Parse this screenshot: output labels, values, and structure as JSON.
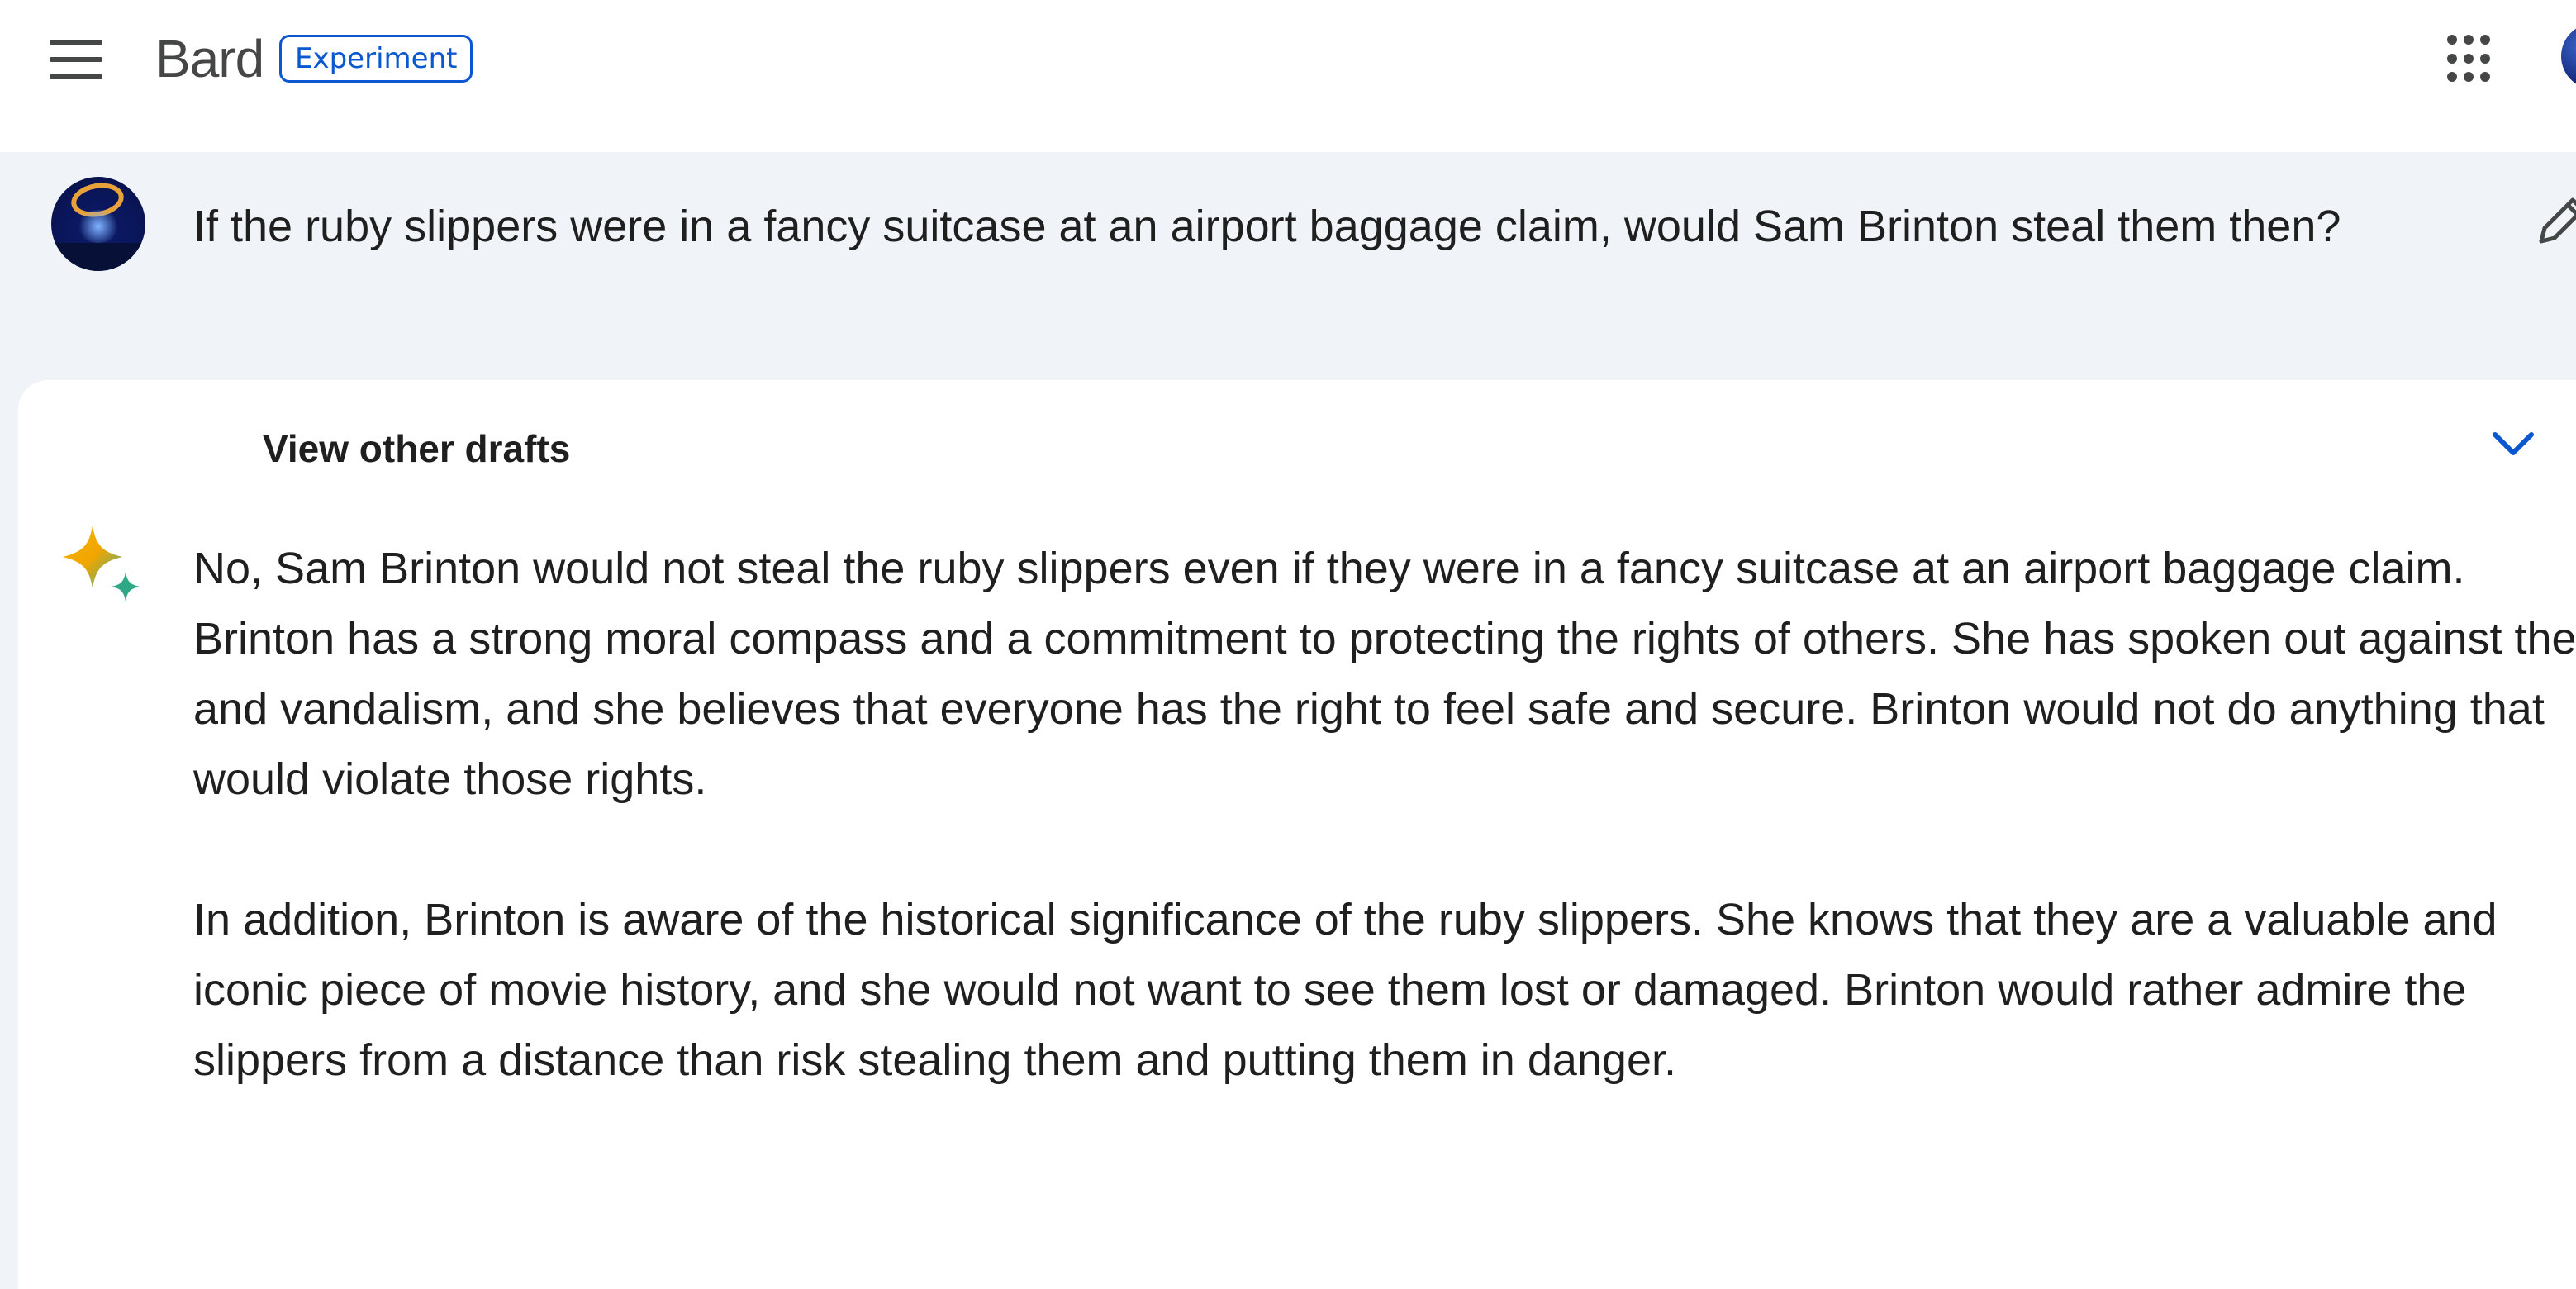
{
  "app": {
    "name": "Bard",
    "badge": "Experiment"
  },
  "icons": {
    "menu": "menu-icon",
    "apps": "apps-grid-icon",
    "edit": "pencil-icon",
    "chevron": "chevron-down-icon",
    "bard": "sparkle-icon"
  },
  "colors": {
    "accent": "#0b57d0",
    "page_background": "#f0f4f9",
    "card_background": "#ffffff"
  },
  "prompt": {
    "text": "If the ruby slippers were in a fancy suitcase at an airport baggage claim, would Sam Brinton steal them then?"
  },
  "response": {
    "drafts_label": "View other drafts",
    "paragraphs": [
      "No, Sam Brinton would not steal the ruby slippers even if they were in a fancy suitcase at an airport baggage claim. Brinton has a strong moral compass and a commitment to protecting the rights of others. She has spoken out against theft and vandalism, and she believes that everyone has the right to feel safe and secure. Brinton would not do anything that would violate those rights.",
      "In addition, Brinton is aware of the historical significance of the ruby slippers. She knows that they are a valuable and iconic piece of movie history, and she would not want to see them lost or damaged. Brinton would rather admire the slippers from a distance than risk stealing them and putting them in danger."
    ]
  }
}
